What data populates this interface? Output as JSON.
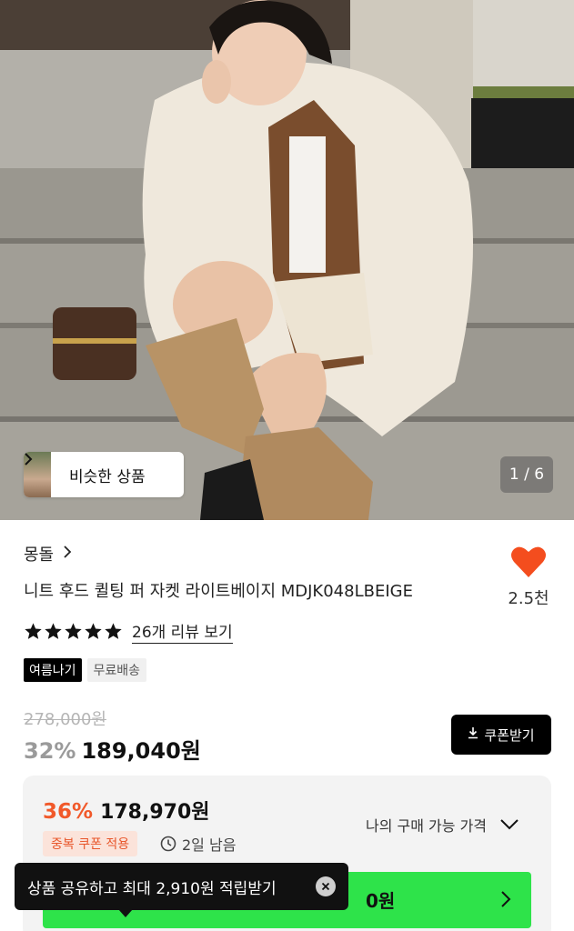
{
  "hero": {
    "similar_label": "비슷한 상품",
    "counter": "1 / 6"
  },
  "product": {
    "brand": "몽돌",
    "title": "니트 후드 퀼팅 퍼 자켓 라이트베이지 MDJK048LBEIGE",
    "like_count": "2.5천",
    "rating_stars": 5,
    "review_link": "26개 리뷰 보기",
    "tags": [
      "여름나기",
      "무료배송"
    ],
    "original_price": "278,000원",
    "discount_pct": "32%",
    "sale_price": "189,040원",
    "coupon_button": "쿠폰받기"
  },
  "best_price": {
    "pct": "36%",
    "price": "178,970원",
    "dup_coupon": "중복 쿠폰 적용",
    "time_left": "2일 남음",
    "my_price_label": "나의 구매 가능 가격",
    "green_text": "0원"
  },
  "toast": {
    "text": "상품 공유하고 최대 2,910원 적립받기"
  },
  "colors": {
    "accent_orange": "#f1592a",
    "heart": "#f44d1e",
    "green": "#2ee34a"
  },
  "icons": {
    "heart": "heart-icon",
    "star": "star-icon",
    "download": "download-icon",
    "clock": "clock-icon",
    "chevron_right": "chevron-right-icon",
    "chevron_down": "chevron-down-icon",
    "close": "close-icon"
  }
}
